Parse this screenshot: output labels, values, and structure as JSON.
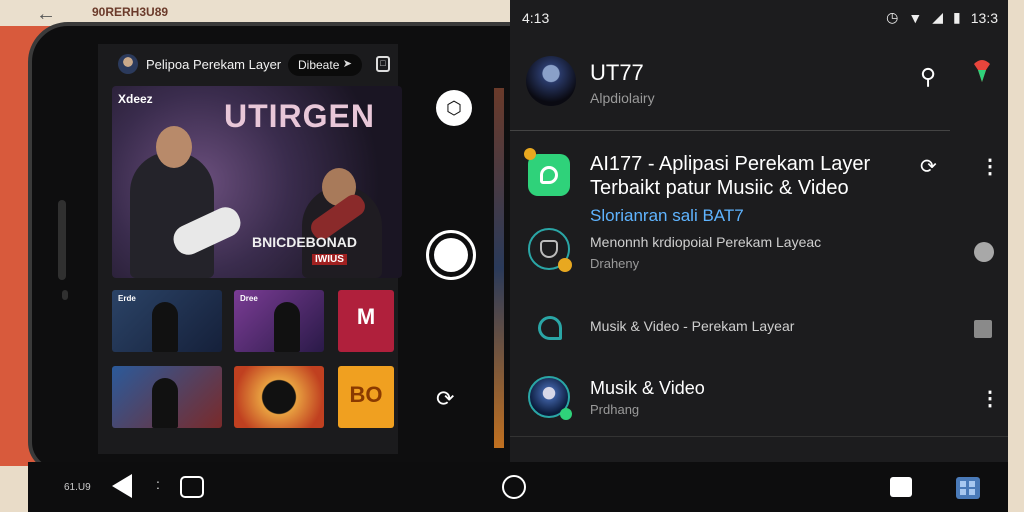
{
  "background": {
    "top_label": "90RERH3U89"
  },
  "left_app": {
    "title": "Pelipoa Perekam Layer",
    "pill_label": "Dibeate",
    "hero": {
      "tag": "Xdeez",
      "title": "UTIRGEN",
      "subtitle": "BNICDEBONAD",
      "badge": "IWIUS"
    },
    "thumbs": [
      {
        "tag": "Erde"
      },
      {
        "tag": "Dree"
      },
      {
        "big": "M"
      },
      {
        "tag": ""
      },
      {
        "tag": ""
      },
      {
        "big": "BO"
      }
    ]
  },
  "status": {
    "time": "4:13",
    "clock": "13:3"
  },
  "header": {
    "title": "UT77",
    "subtitle": "Alpdiolairy"
  },
  "items": [
    {
      "title_line1": "AI177 - Aplipasi Perekam Layer",
      "title_line2": "Terbaikt   patur Musiic & Video",
      "link": "Slorianran sali BAT7"
    },
    {
      "title": "Menonnh krdiopoial Perekam Layeac",
      "sub": "Draheny"
    },
    {
      "title": "Musik & Video - Perekam Layear"
    },
    {
      "title": "Musik & Video",
      "sub": "Prdhang"
    }
  ],
  "navbar": {
    "left_text": "61.U9",
    "colon": ":"
  },
  "colors": {
    "accent_green": "#2fd27a",
    "link_blue": "#5fb4ff",
    "panel_bg": "#1c1c1e"
  }
}
